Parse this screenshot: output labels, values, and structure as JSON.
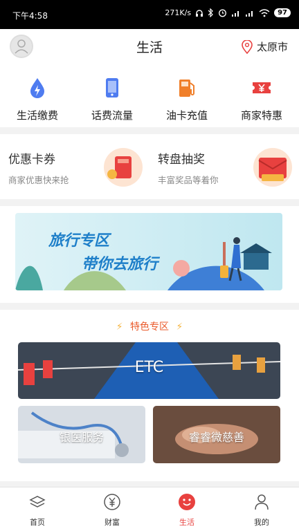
{
  "status_bar": {
    "time": "下午4:58",
    "network_speed": "271K/s",
    "battery": "97"
  },
  "header": {
    "title": "生活",
    "city": "太原市"
  },
  "quick_actions": [
    {
      "label": "生活缴费",
      "icon": "water-drop-bolt-icon",
      "color": "#4f7cf0"
    },
    {
      "label": "话费流量",
      "icon": "phone-icon",
      "color": "#4f7cf0"
    },
    {
      "label": "油卡充值",
      "icon": "fuel-pump-icon",
      "color": "#f07f2a"
    },
    {
      "label": "商家特惠",
      "icon": "yen-ticket-icon",
      "color": "#e8413f"
    }
  ],
  "promos": [
    {
      "title": "优惠卡券",
      "subtitle": "商家优惠快来抢"
    },
    {
      "title": "转盘抽奖",
      "subtitle": "丰富奖品等着你"
    }
  ],
  "travel_banner": {
    "line1": "旅行专区",
    "line2": "带你去旅行"
  },
  "featured": {
    "title": "特色专区",
    "etc": "ETC",
    "tiles": [
      "银医服务",
      "睿睿微慈善"
    ]
  },
  "tabs": [
    {
      "label": "首页",
      "icon": "home-layers-icon",
      "active": false
    },
    {
      "label": "财富",
      "icon": "yen-circle-icon",
      "active": false
    },
    {
      "label": "生活",
      "icon": "smiley-icon",
      "active": true
    },
    {
      "label": "我的",
      "icon": "person-icon",
      "active": false
    }
  ],
  "colors": {
    "accent": "#e8413f",
    "featured_title": "#ea5b2c",
    "banner_text": "#1e7fc9"
  }
}
